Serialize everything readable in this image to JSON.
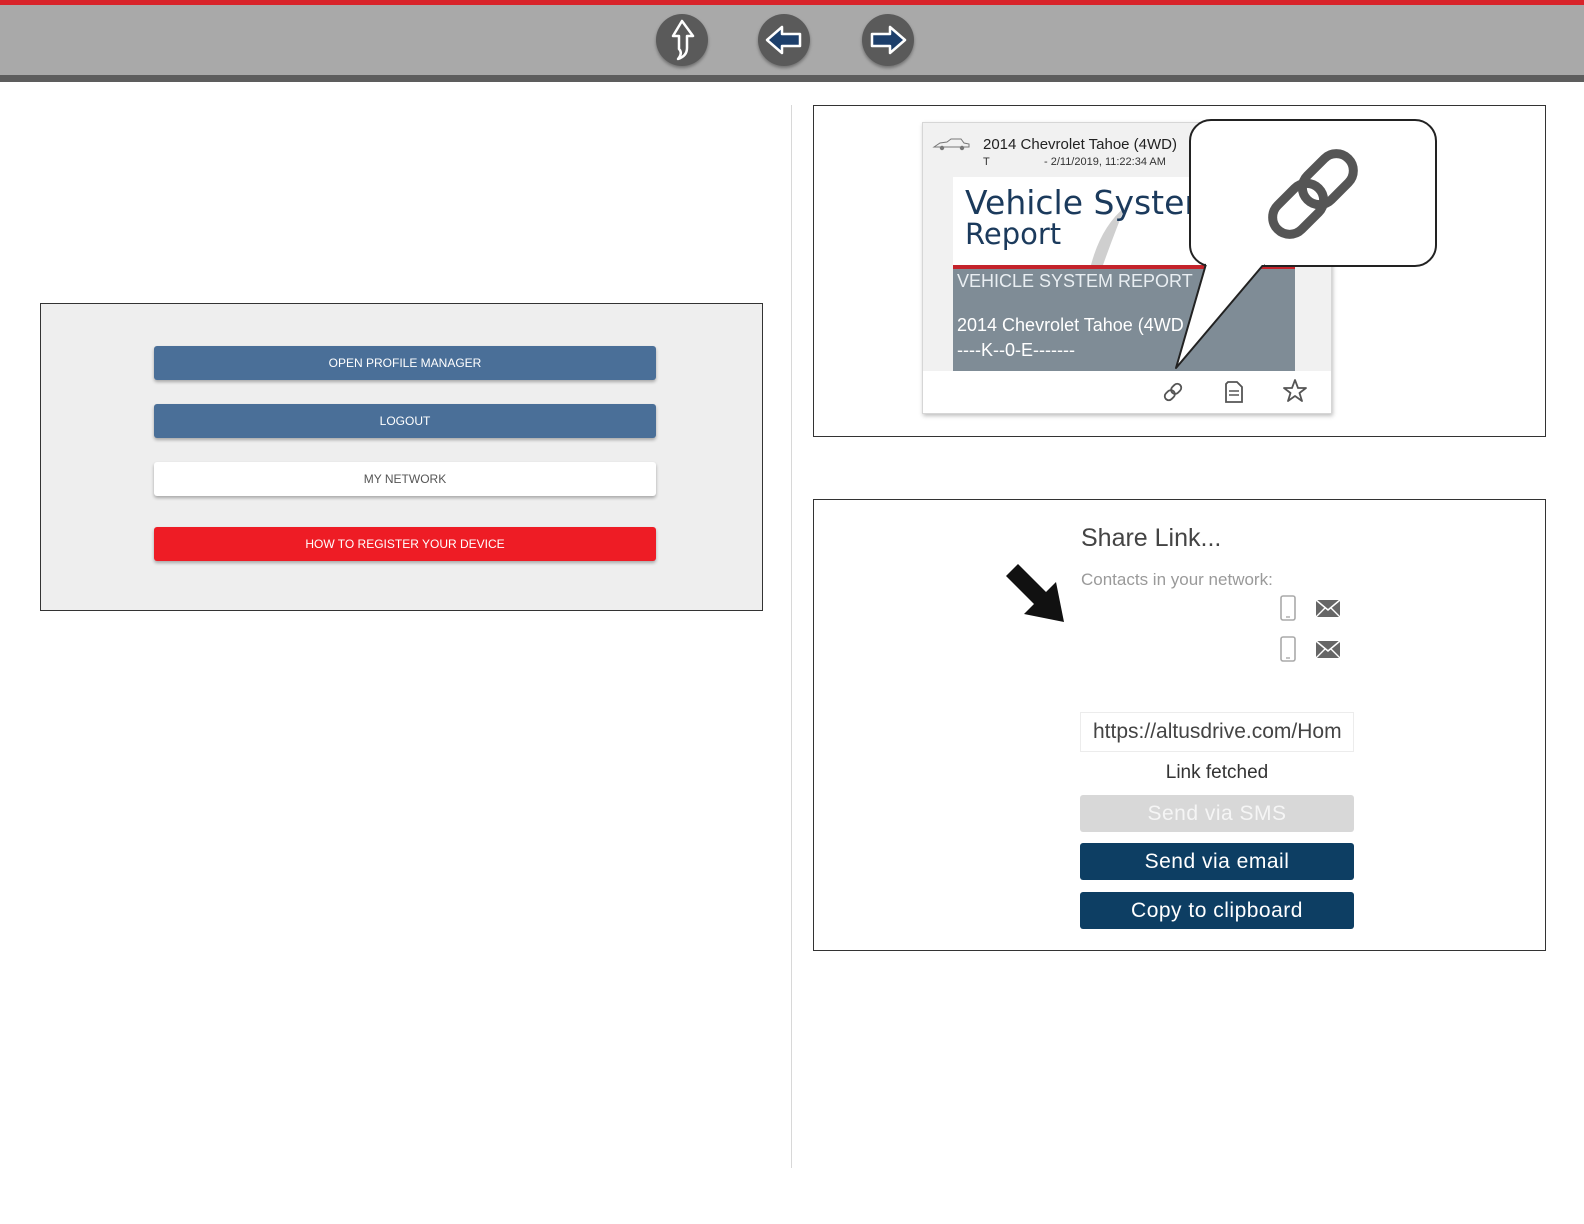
{
  "toolbar": {
    "accent_color": "#d8232a",
    "buttons": [
      {
        "icon": "up-arrow-icon"
      },
      {
        "icon": "back-arrow-icon"
      },
      {
        "icon": "forward-arrow-icon"
      }
    ]
  },
  "profile_menu": {
    "buttons": [
      {
        "label": "OPEN PROFILE MANAGER",
        "color": "#4a6f98"
      },
      {
        "label": "LOGOUT",
        "color": "#4a6f98"
      },
      {
        "label": "MY NETWORK",
        "color": "#ffffff"
      },
      {
        "label": "HOW TO REGISTER YOUR DEVICE",
        "color": "#ee1c25"
      }
    ]
  },
  "report_card": {
    "vehicle_title": "2014 Chevrolet Tahoe (4WD)",
    "subline_prefix": "T",
    "timestamp": "- 2/11/2019, 11:22:34 AM",
    "report_title_line1": "Vehicle System",
    "report_title_line2": "Report",
    "report_header": "VEHICLE SYSTEM REPORT",
    "report_vehicle": "2014  Chevrolet  Tahoe  (4WD",
    "report_vin": "----K--0-E-------",
    "actions": [
      {
        "icon": "link-icon"
      },
      {
        "icon": "document-icon"
      },
      {
        "icon": "star-icon"
      }
    ],
    "callout_icon": "link-icon"
  },
  "share_dialog": {
    "title": "Share Link...",
    "contacts_label": "Contacts in your network:",
    "contacts": [
      {
        "icons": [
          "phone-icon",
          "mail-icon"
        ]
      },
      {
        "icons": [
          "phone-icon",
          "mail-icon"
        ]
      }
    ],
    "url": "https://altusdrive.com/Hom",
    "status": "Link fetched",
    "send_sms_label": "Send via SMS",
    "send_email_label": "Send via email",
    "copy_label": "Copy to clipboard",
    "primary_color": "#0d3e63"
  }
}
